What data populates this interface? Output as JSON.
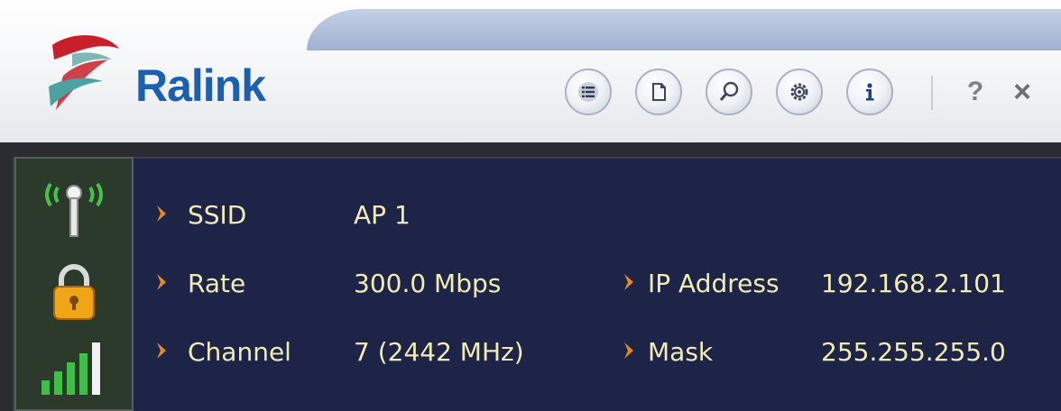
{
  "brand": {
    "name": "Ralink"
  },
  "toolbar": {
    "buttons": [
      {
        "icon": "list-icon"
      },
      {
        "icon": "document-icon"
      },
      {
        "icon": "search-icon"
      },
      {
        "icon": "gear-icon"
      },
      {
        "icon": "info-icon"
      }
    ],
    "help_label": "?",
    "close_label": "×"
  },
  "status": {
    "ssid": {
      "label": "SSID",
      "value": "AP 1"
    },
    "rate": {
      "label": "Rate",
      "value": "300.0 Mbps"
    },
    "channel": {
      "label": "Channel",
      "value": "7 (2442 MHz)"
    },
    "ip": {
      "label": "IP Address",
      "value": "192.168.2.101"
    },
    "mask": {
      "label": "Mask",
      "value": "255.255.255.0"
    },
    "icons": [
      "antenna-icon",
      "lock-icon",
      "signal-strength-icon"
    ]
  },
  "colors": {
    "panel_bg": "#1d2447",
    "text": "#f1ebb4",
    "bullet": "#e58a2a",
    "brand_blue": "#1c5fae"
  }
}
